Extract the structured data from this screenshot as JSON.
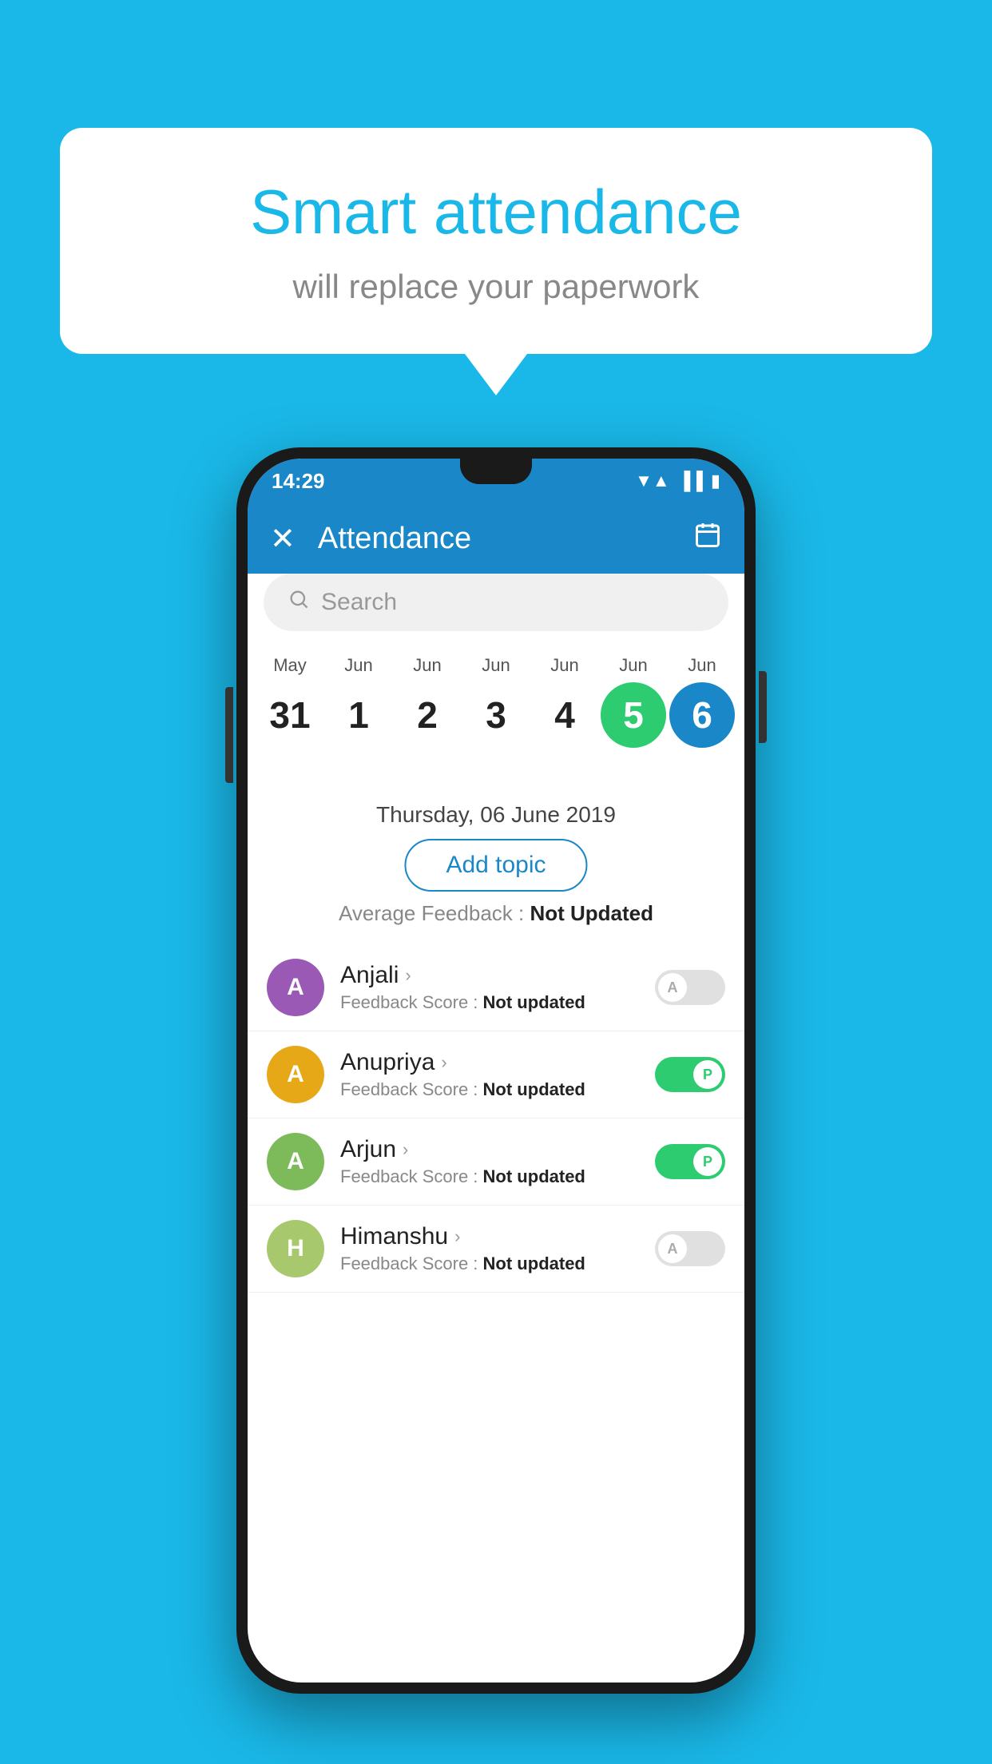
{
  "background_color": "#1ab8e8",
  "speech_bubble": {
    "title": "Smart attendance",
    "subtitle": "will replace your paperwork"
  },
  "status_bar": {
    "time": "14:29",
    "icons": [
      "wifi",
      "signal",
      "battery"
    ]
  },
  "app_bar": {
    "close_label": "✕",
    "title": "Attendance",
    "calendar_icon": "📅"
  },
  "search": {
    "placeholder": "Search"
  },
  "dates": [
    {
      "month": "May",
      "day": "31",
      "state": "normal"
    },
    {
      "month": "Jun",
      "day": "1",
      "state": "normal"
    },
    {
      "month": "Jun",
      "day": "2",
      "state": "normal"
    },
    {
      "month": "Jun",
      "day": "3",
      "state": "normal"
    },
    {
      "month": "Jun",
      "day": "4",
      "state": "normal"
    },
    {
      "month": "Jun",
      "day": "5",
      "state": "today"
    },
    {
      "month": "Jun",
      "day": "6",
      "state": "selected"
    }
  ],
  "selected_date_label": "Thursday, 06 June 2019",
  "add_topic_label": "Add topic",
  "average_feedback": {
    "label": "Average Feedback : ",
    "value": "Not Updated"
  },
  "students": [
    {
      "name": "Anjali",
      "avatar_letter": "A",
      "avatar_color": "#9b59b6",
      "feedback_label": "Feedback Score : ",
      "feedback_value": "Not updated",
      "attendance": "absent",
      "toggle_label": "A"
    },
    {
      "name": "Anupriya",
      "avatar_letter": "A",
      "avatar_color": "#e6a817",
      "feedback_label": "Feedback Score : ",
      "feedback_value": "Not updated",
      "attendance": "present",
      "toggle_label": "P"
    },
    {
      "name": "Arjun",
      "avatar_letter": "A",
      "avatar_color": "#7dbb5a",
      "feedback_label": "Feedback Score : ",
      "feedback_value": "Not updated",
      "attendance": "present",
      "toggle_label": "P"
    },
    {
      "name": "Himanshu",
      "avatar_letter": "H",
      "avatar_color": "#a8c86d",
      "feedback_label": "Feedback Score : ",
      "feedback_value": "Not updated",
      "attendance": "absent",
      "toggle_label": "A"
    }
  ]
}
